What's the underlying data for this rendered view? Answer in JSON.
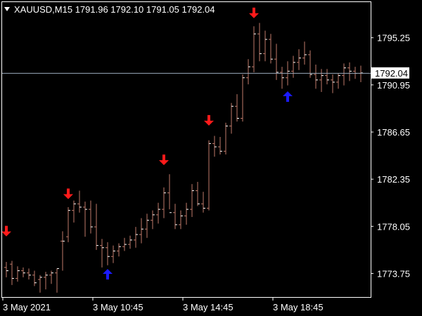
{
  "chart_data": {
    "type": "ohlc",
    "title": {
      "symbol": "XAUUSD,M15",
      "open": "1791.96",
      "high": "1792.10",
      "low": "1791.05",
      "close": "1792.04"
    },
    "colors": {
      "background": "#000000",
      "frame": "#ffffff",
      "bar": "#c07a6a",
      "bar_close": "#ffffff",
      "price_line": "#9aaabb",
      "sell_arrow": "#ff1a1a",
      "buy_arrow": "#1a1aff",
      "price_label_bg": "#ffffff",
      "price_label_text": "#000000"
    },
    "y_axis": {
      "range": [
        1771.6,
        1798.5
      ],
      "ticks": [
        "1795.25",
        "1790.95",
        "1786.65",
        "1782.35",
        "1778.05",
        "1773.75"
      ]
    },
    "x_axis": {
      "ticks": [
        "3 May 2021",
        "3 May 10:45",
        "3 May 14:45",
        "3 May 18:45"
      ],
      "tick_bar_index": [
        0,
        16,
        32,
        48
      ]
    },
    "current_price": "1792.04",
    "bars": [
      [
        1774.3,
        1774.8,
        1773.4,
        1774.0
      ],
      [
        1774.6,
        1774.9,
        1772.7,
        1773.3
      ],
      [
        1773.3,
        1774.4,
        1773.0,
        1774.0
      ],
      [
        1774.0,
        1774.3,
        1773.4,
        1773.8
      ],
      [
        1773.8,
        1774.2,
        1773.2,
        1773.6
      ],
      [
        1773.6,
        1774.0,
        1772.6,
        1772.9
      ],
      [
        1773.2,
        1773.6,
        1772.0,
        1773.4
      ],
      [
        1773.4,
        1773.9,
        1772.3,
        1773.6
      ],
      [
        1773.6,
        1774.0,
        1772.8,
        1773.8
      ],
      [
        1773.8,
        1774.2,
        1772.0,
        1774.2
      ],
      [
        1776.7,
        1777.6,
        1774.0,
        1776.7
      ],
      [
        1777.1,
        1779.8,
        1776.6,
        1779.5
      ],
      [
        1779.5,
        1780.4,
        1778.4,
        1780.1
      ],
      [
        1780.1,
        1781.3,
        1779.3,
        1779.8
      ],
      [
        1779.8,
        1780.3,
        1777.1,
        1779.6
      ],
      [
        1779.6,
        1780.4,
        1777.4,
        1778.0
      ],
      [
        1778.0,
        1780.1,
        1775.9,
        1776.3
      ],
      [
        1776.3,
        1776.9,
        1774.3,
        1776.1
      ],
      [
        1776.1,
        1776.6,
        1774.5,
        1775.3
      ],
      [
        1775.3,
        1776.3,
        1774.7,
        1775.8
      ],
      [
        1775.8,
        1776.5,
        1775.3,
        1776.2
      ],
      [
        1776.2,
        1777.0,
        1775.8,
        1776.4
      ],
      [
        1776.4,
        1777.2,
        1776.0,
        1776.8
      ],
      [
        1776.8,
        1778.0,
        1776.1,
        1777.3
      ],
      [
        1777.3,
        1778.8,
        1776.5,
        1777.8
      ],
      [
        1777.8,
        1779.2,
        1777.0,
        1778.6
      ],
      [
        1778.6,
        1779.5,
        1777.8,
        1779.1
      ],
      [
        1779.1,
        1780.2,
        1778.3,
        1779.6
      ],
      [
        1779.6,
        1781.6,
        1778.8,
        1781.1
      ],
      [
        1781.1,
        1782.8,
        1779.6,
        1779.3
      ],
      [
        1779.3,
        1780.1,
        1777.8,
        1778.2
      ],
      [
        1778.2,
        1779.5,
        1777.8,
        1779.0
      ],
      [
        1779.0,
        1780.2,
        1778.2,
        1779.6
      ],
      [
        1779.6,
        1781.9,
        1778.9,
        1781.3
      ],
      [
        1781.3,
        1782.1,
        1779.9,
        1780.1
      ],
      [
        1780.1,
        1781.2,
        1779.3,
        1779.7
      ],
      [
        1779.7,
        1785.9,
        1779.5,
        1785.6
      ],
      [
        1785.6,
        1786.3,
        1784.4,
        1785.3
      ],
      [
        1785.3,
        1786.2,
        1784.6,
        1784.9
      ],
      [
        1784.9,
        1787.5,
        1784.6,
        1787.2
      ],
      [
        1787.2,
        1789.3,
        1786.5,
        1789.0
      ],
      [
        1789.0,
        1790.1,
        1787.6,
        1787.9
      ],
      [
        1787.9,
        1791.9,
        1787.6,
        1791.6
      ],
      [
        1791.6,
        1793.3,
        1791.0,
        1792.6
      ],
      [
        1792.6,
        1796.3,
        1792.1,
        1795.6
      ],
      [
        1795.6,
        1796.6,
        1793.1,
        1793.8
      ],
      [
        1793.8,
        1795.9,
        1793.1,
        1795.1
      ],
      [
        1795.1,
        1795.6,
        1792.9,
        1793.3
      ],
      [
        1793.3,
        1794.7,
        1791.4,
        1792.1
      ],
      [
        1792.1,
        1792.6,
        1790.6,
        1791.6
      ],
      [
        1791.6,
        1793.1,
        1790.9,
        1792.2
      ],
      [
        1792.2,
        1793.6,
        1791.6,
        1793.0
      ],
      [
        1793.0,
        1794.2,
        1792.3,
        1793.4
      ],
      [
        1793.4,
        1794.9,
        1792.8,
        1793.7
      ],
      [
        1793.7,
        1794.1,
        1791.6,
        1791.9
      ],
      [
        1791.9,
        1792.8,
        1790.6,
        1791.4
      ],
      [
        1791.4,
        1792.4,
        1790.3,
        1791.8
      ],
      [
        1791.8,
        1792.4,
        1791.0,
        1791.4
      ],
      [
        1791.4,
        1791.9,
        1790.2,
        1791.2
      ],
      [
        1791.2,
        1792.0,
        1790.6,
        1791.8
      ],
      [
        1791.8,
        1792.9,
        1790.9,
        1792.5
      ],
      [
        1792.5,
        1793.0,
        1791.3,
        1792.2
      ],
      [
        1792.2,
        1792.6,
        1791.5,
        1792.0
      ],
      [
        1792.0,
        1792.7,
        1791.2,
        1792.04
      ]
    ],
    "signals": [
      {
        "bar": 0,
        "type": "sell",
        "price": 1777.2
      },
      {
        "bar": 11,
        "type": "sell",
        "price": 1780.6
      },
      {
        "bar": 18,
        "type": "buy",
        "price": 1774.1
      },
      {
        "bar": 28,
        "type": "sell",
        "price": 1783.7
      },
      {
        "bar": 36,
        "type": "sell",
        "price": 1787.3
      },
      {
        "bar": 44,
        "type": "sell",
        "price": 1797.1
      },
      {
        "bar": 50,
        "type": "buy",
        "price": 1790.3
      }
    ]
  }
}
